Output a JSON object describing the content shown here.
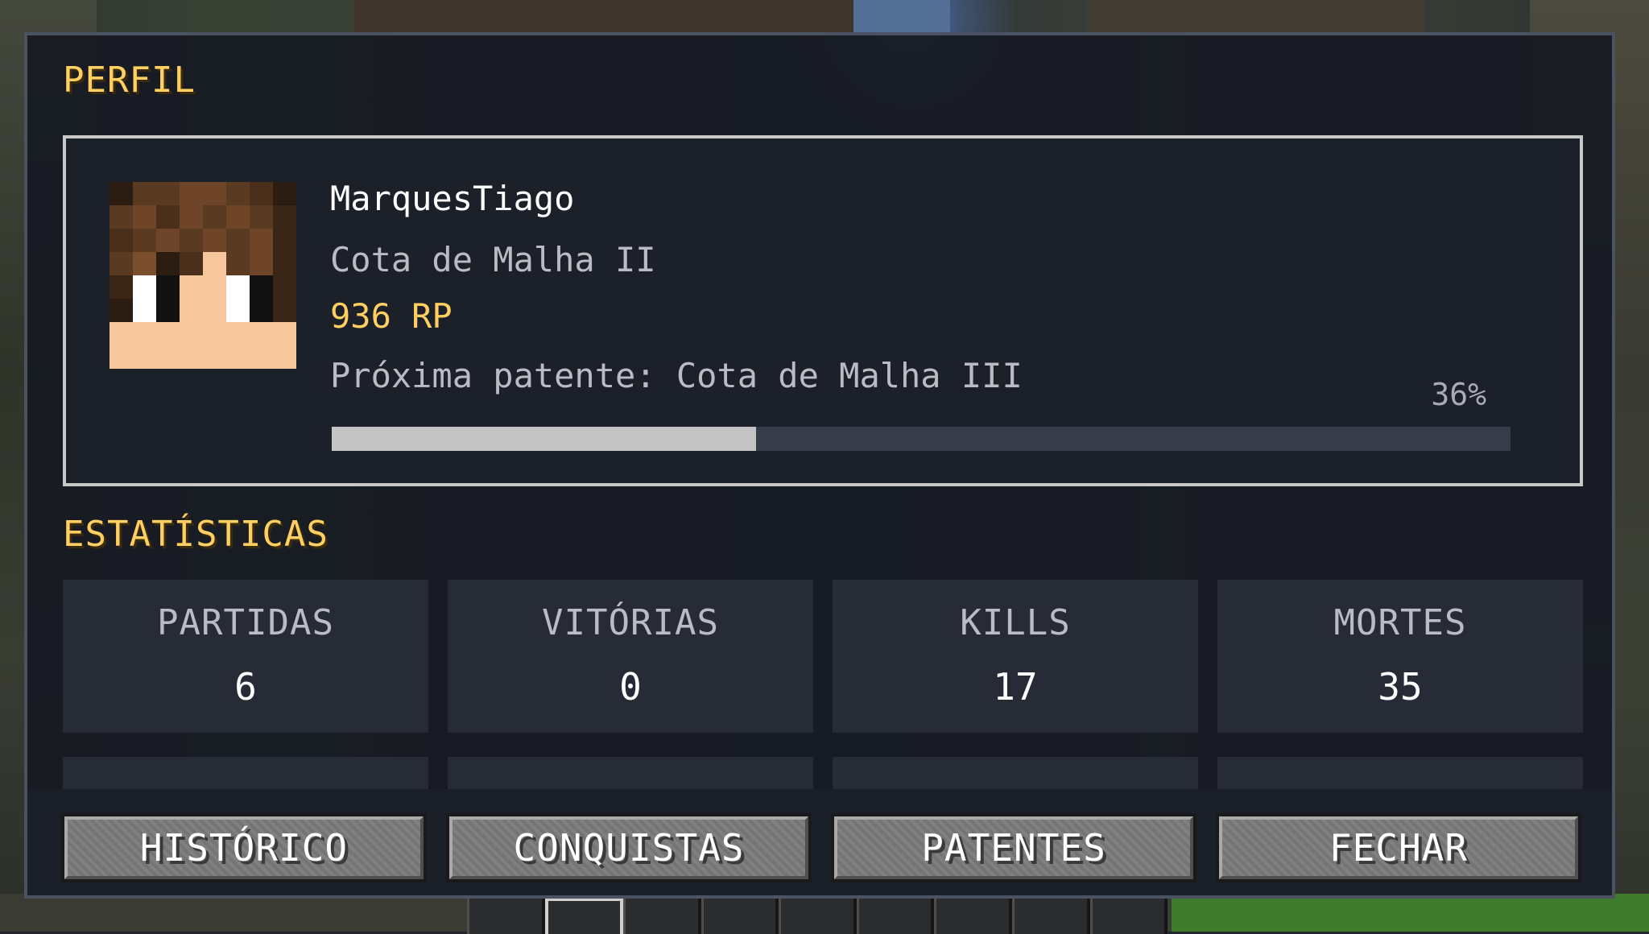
{
  "panel": {
    "profile_title": "PERFIL",
    "stats_title": "ESTATÍSTICAS"
  },
  "profile": {
    "username": "MarquesTiago",
    "rank": "Cota de Malha II",
    "rp": "936 RP",
    "next_rank": "Próxima patente: Cota de Malha III",
    "progress_percent_label": "36%",
    "progress_fraction": 0.36
  },
  "stats": [
    {
      "label": "PARTIDAS",
      "value": "6"
    },
    {
      "label": "VITÓRIAS",
      "value": "0"
    },
    {
      "label": "KILLS",
      "value": "17"
    },
    {
      "label": "MORTES",
      "value": "35"
    }
  ],
  "buttons": {
    "history": "HISTÓRICO",
    "achievements": "CONQUISTAS",
    "ranks": "PATENTES",
    "close": "FECHAR"
  },
  "colors": {
    "accent": "#ffcf61",
    "progress_fill": "#c4c4c4",
    "progress_track": "#363c4a"
  },
  "avatar_pixels": [
    [
      "#2b1d12",
      "#5a3a21",
      "#5a3a21",
      "#6e4528",
      "#6e4528",
      "#5a3a21",
      "#4a2f1b",
      "#2b1d12"
    ],
    [
      "#5a3a21",
      "#6e4528",
      "#4a2f1b",
      "#6e4528",
      "#5a3a21",
      "#6e4528",
      "#5a3a21",
      "#3a2616"
    ],
    [
      "#4a2f1b",
      "#5a3a21",
      "#6e4528",
      "#5a3a21",
      "#6e4528",
      "#5a3a21",
      "#6e4528",
      "#3a2616"
    ],
    [
      "#5a3a21",
      "#7a4e2d",
      "#2b1d12",
      "#4a2f1b",
      "#f5c79b",
      "#5a3a21",
      "#6e4528",
      "#3a2616"
    ],
    [
      "#3a2616",
      "#ffffff",
      "#111111",
      "#f5c79b",
      "#f5c79b",
      "#ffffff",
      "#111111",
      "#3a2616"
    ],
    [
      "#2b1d12",
      "#ffffff",
      "#111111",
      "#f5c79b",
      "#f5c79b",
      "#ffffff",
      "#111111",
      "#3a2616"
    ],
    [
      "#f5c79b",
      "#f5c79b",
      "#f5c79b",
      "#f5c79b",
      "#f5c79b",
      "#f5c79b",
      "#f5c79b",
      "#f5c79b"
    ],
    [
      "#f5c79b",
      "#f5c79b",
      "#f5c79b",
      "#f5c79b",
      "#f5c79b",
      "#f5c79b",
      "#f5c79b",
      "#f5c79b"
    ]
  ]
}
